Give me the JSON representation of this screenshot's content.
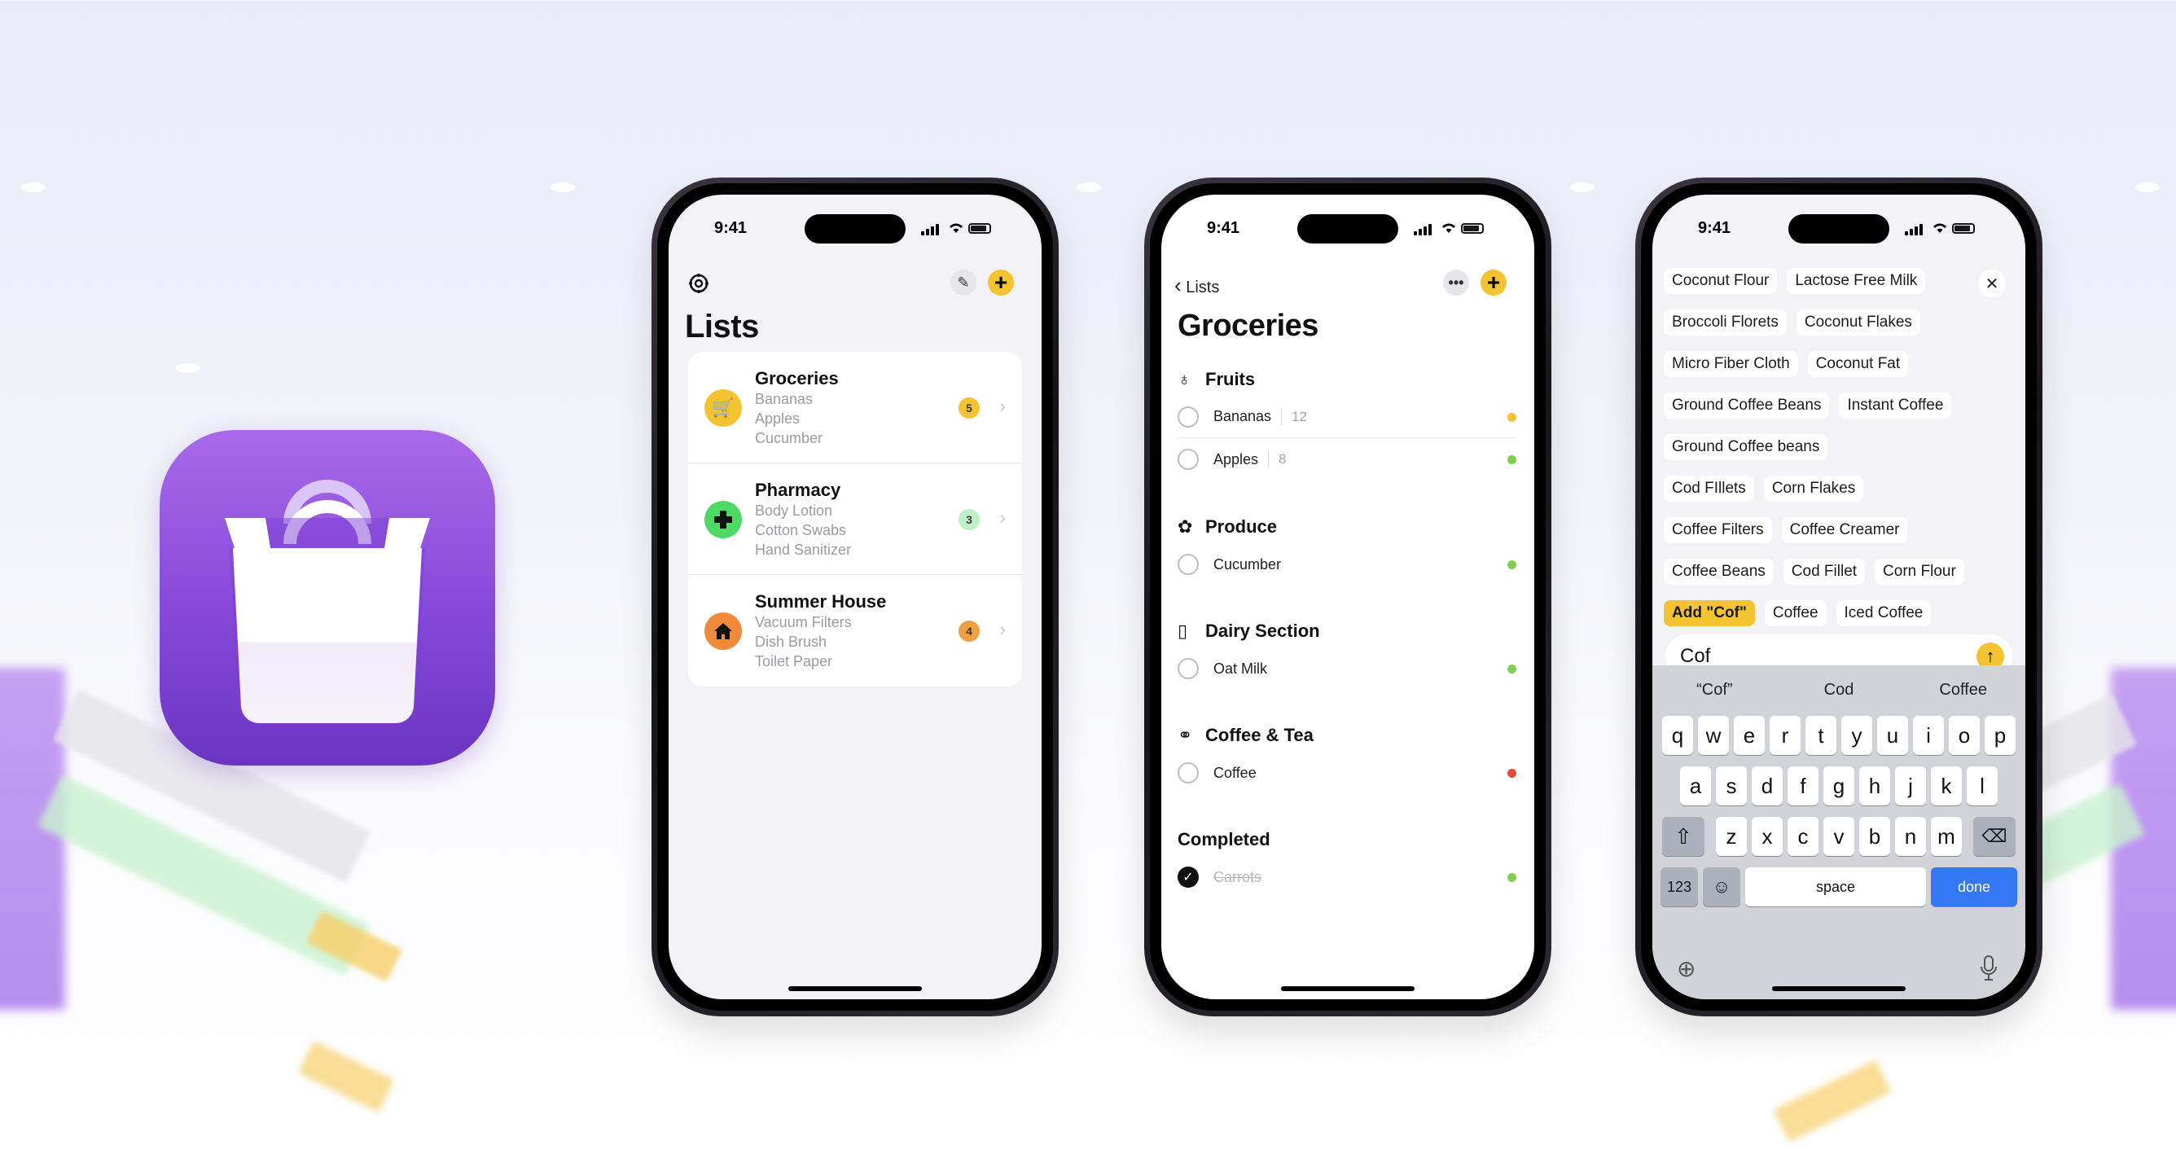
{
  "status": {
    "time": "9:41"
  },
  "screen1": {
    "title": "Lists",
    "lists": [
      {
        "name": "Groceries",
        "items": [
          "Bananas",
          "Apples",
          "Cucumber"
        ],
        "count": "5",
        "icon": "cart-icon",
        "icon_color": "#f4c331",
        "badge_color": "#f4c331"
      },
      {
        "name": "Pharmacy",
        "items": [
          "Body Lotion",
          "Cotton Swabs",
          "Hand Sanitizer"
        ],
        "count": "3",
        "icon": "medical-cross-icon",
        "icon_color": "#4cd964",
        "badge_color": "#bff0c5"
      },
      {
        "name": "Summer House",
        "items": [
          "Vacuum Filters",
          "Dish Brush",
          "Toilet Paper"
        ],
        "count": "4",
        "icon": "house-icon",
        "icon_color": "#f08a3a",
        "badge_color": "#f0a040"
      }
    ]
  },
  "screen2": {
    "back_label": "Lists",
    "title": "Groceries",
    "sections": [
      {
        "name": "Fruits",
        "icon": "pear-icon",
        "items": [
          {
            "name": "Bananas",
            "qty": "12",
            "dot": "#f4c331"
          },
          {
            "name": "Apples",
            "qty": "8",
            "dot": "#7ccf4f"
          }
        ]
      },
      {
        "name": "Produce",
        "icon": "broccoli-icon",
        "items": [
          {
            "name": "Cucumber",
            "qty": "",
            "dot": "#7ccf4f"
          }
        ]
      },
      {
        "name": "Dairy Section",
        "icon": "bottle-icon",
        "items": [
          {
            "name": "Oat Milk",
            "qty": "",
            "dot": "#7ccf4f"
          }
        ]
      },
      {
        "name": "Coffee & Tea",
        "icon": "coffee-beans-icon",
        "items": [
          {
            "name": "Coffee",
            "qty": "",
            "dot": "#e24a3b"
          }
        ]
      },
      {
        "name": "Completed",
        "icon": "",
        "items": [
          {
            "name": "Carrots",
            "qty": "",
            "dot": "#7ccf4f",
            "done": true
          }
        ]
      }
    ]
  },
  "screen3": {
    "chips": [
      [
        "Coconut Flour",
        "Lactose Free Milk"
      ],
      [
        "Broccoli Florets",
        "Coconut Flakes"
      ],
      [
        "Micro Fiber Cloth",
        "Coconut Fat"
      ],
      [
        "Ground Coffee Beans",
        "Instant Coffee"
      ],
      [
        "Ground Coffee beans"
      ],
      [
        "Cod FIllets",
        "Corn Flakes"
      ],
      [
        "Coffee Filters",
        "Coffee Creamer"
      ],
      [
        "Coffee Beans",
        "Cod Fillet",
        "Corn Flour"
      ],
      [
        "Add \"Cof\"",
        "Coffee",
        "Iced Coffee"
      ]
    ],
    "input_value": "Cof",
    "suggestions": [
      "“Cof”",
      "Cod",
      "Coffee"
    ],
    "keys_row1": [
      "q",
      "w",
      "e",
      "r",
      "t",
      "y",
      "u",
      "i",
      "o",
      "p"
    ],
    "keys_row2": [
      "a",
      "s",
      "d",
      "f",
      "g",
      "h",
      "j",
      "k",
      "l"
    ],
    "keys_row3": [
      "z",
      "x",
      "c",
      "v",
      "b",
      "n",
      "m"
    ],
    "numbers_key": "123",
    "space_key": "space",
    "done_key": "done"
  }
}
